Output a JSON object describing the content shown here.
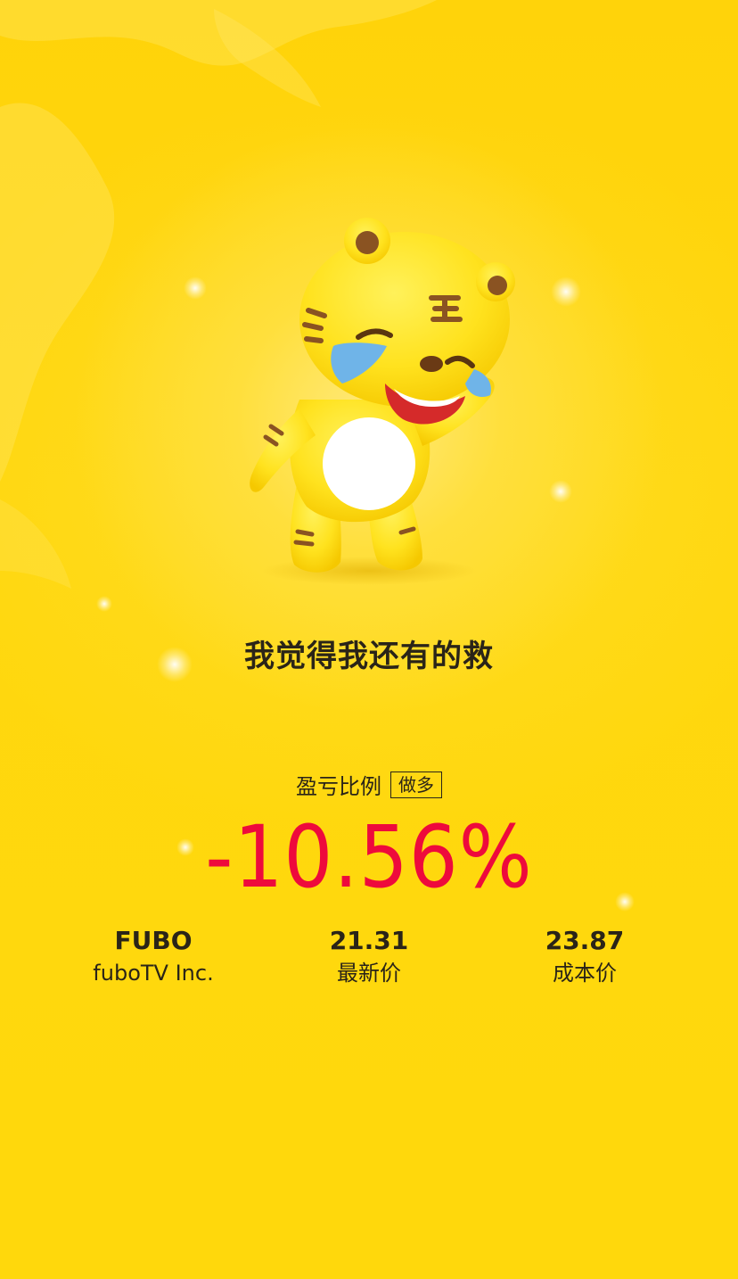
{
  "slogan": "我觉得我还有的救",
  "ratio": {
    "label": "盈亏比例",
    "direction": "做多",
    "value": "-10.56%",
    "value_color": "#EE0A3C"
  },
  "stock": {
    "ticker": "FUBO",
    "name": "fuboTV Inc.",
    "last_price": "21.31",
    "last_price_label": "最新价",
    "cost_price": "23.87",
    "cost_price_label": "成本价"
  },
  "theme": {
    "background": "#FFD400",
    "text": "#2A2418"
  },
  "mascot": {
    "icon": "crying-tiger-mascot-icon"
  }
}
